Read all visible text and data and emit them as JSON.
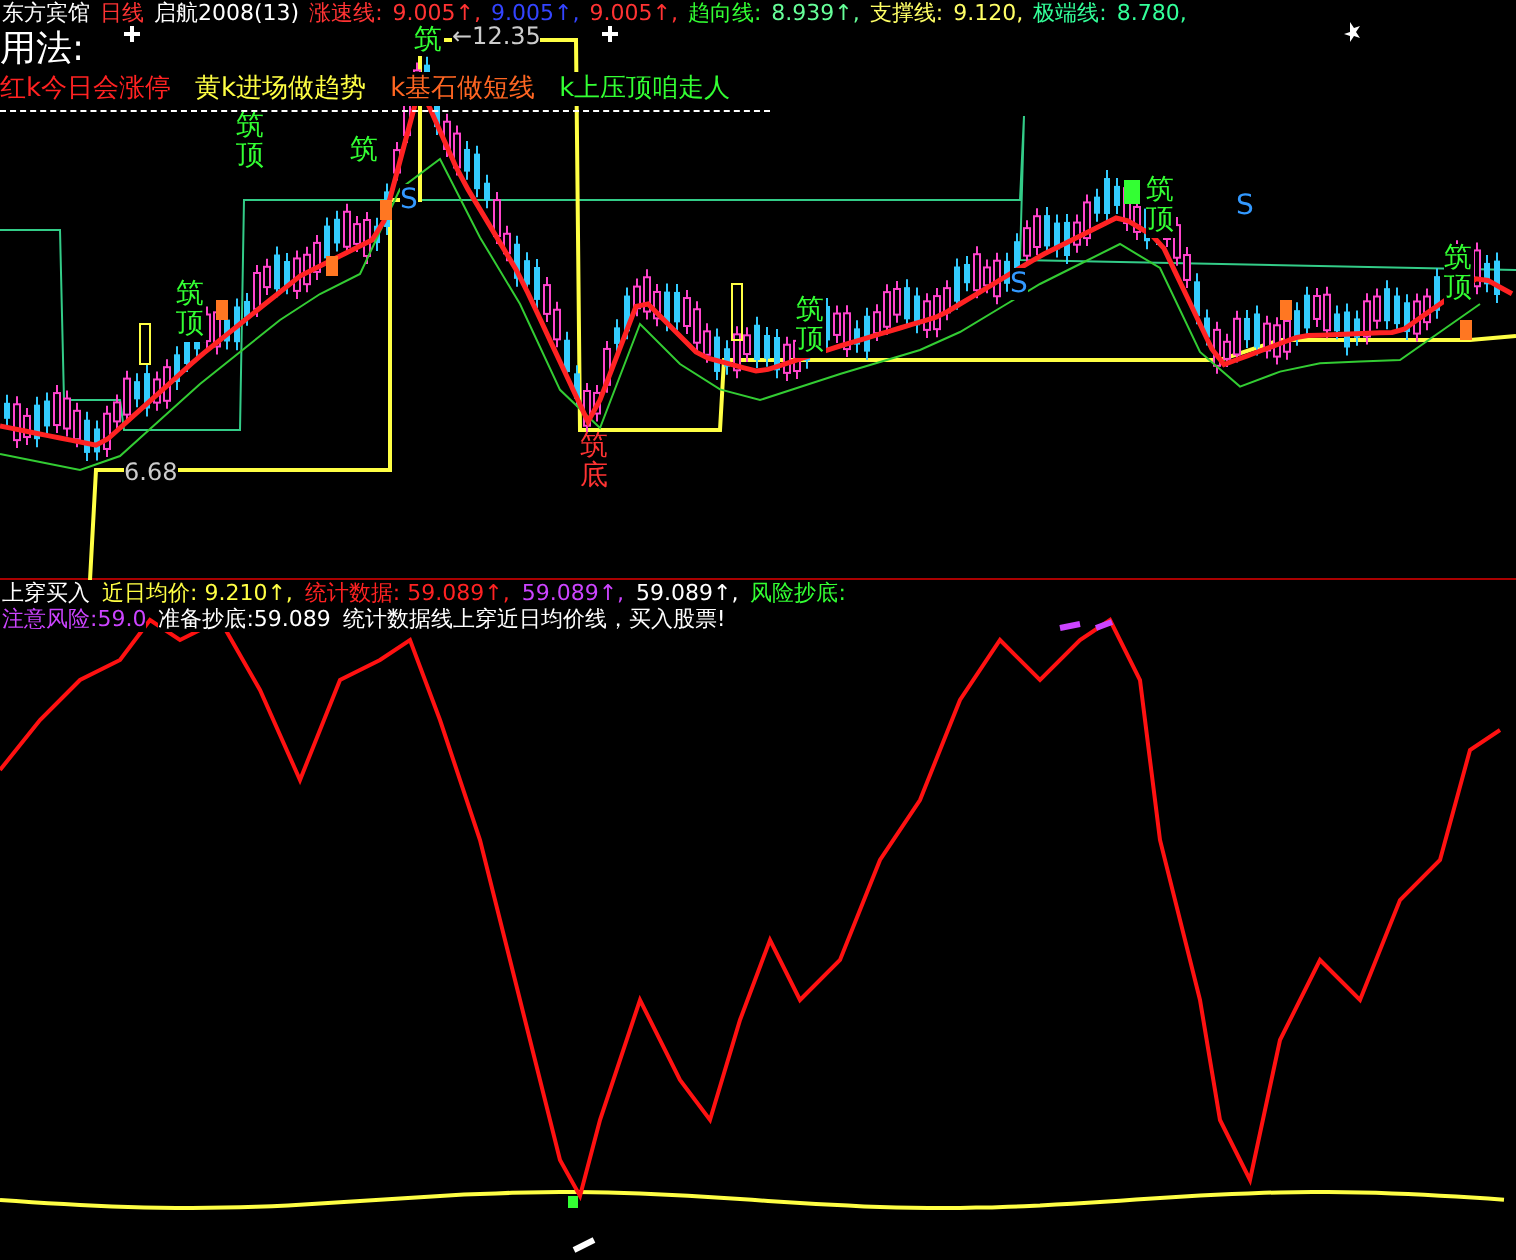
{
  "header": {
    "items": [
      {
        "text": "东方宾馆",
        "color": "#ffffff"
      },
      {
        "text": "日线",
        "color": "#ff3333"
      },
      {
        "text": "启航2008(13)",
        "color": "#ffffff"
      },
      {
        "text": "涨速线:",
        "color": "#ff3333"
      },
      {
        "text": "9.005↑,",
        "color": "#ff3333"
      },
      {
        "text": "9.005↑,",
        "color": "#3344ff"
      },
      {
        "text": "9.005↑,",
        "color": "#ff3333"
      },
      {
        "text": "趋向线:",
        "color": "#33ff33"
      },
      {
        "text": "8.939↑,",
        "color": "#66ff99"
      },
      {
        "text": "支撑线:",
        "color": "#ffff66"
      },
      {
        "text": "9.120,",
        "color": "#ffff66"
      },
      {
        "text": "极端线:",
        "color": "#33ff99"
      },
      {
        "text": "8.780,",
        "color": "#33ff99"
      }
    ]
  },
  "usage": {
    "title": "用法:",
    "legend": [
      {
        "text": "红k今日会涨停",
        "color": "#ff2222"
      },
      {
        "text": "黄k进场做趋势",
        "color": "#ffff44"
      },
      {
        "text": "k基石做短线",
        "color": "#ff6622"
      },
      {
        "text": "k上压顶咱走人",
        "color": "#33ff33"
      }
    ]
  },
  "main_chart": {
    "labels": [
      {
        "text": "←12.35",
        "kind": "price"
      },
      {
        "text": "筑",
        "kind": "top"
      },
      {
        "text": "筑顶",
        "kind": "top"
      },
      {
        "text": "筑",
        "kind": "top"
      },
      {
        "text": "筑顶",
        "kind": "top"
      },
      {
        "text": "S",
        "kind": "s"
      },
      {
        "text": "筑顶",
        "kind": "top"
      },
      {
        "text": "S",
        "kind": "s"
      },
      {
        "text": "筑顶",
        "kind": "top"
      },
      {
        "text": "S",
        "kind": "s"
      },
      {
        "text": "筑顶",
        "kind": "top"
      },
      {
        "text": "筑底",
        "kind": "bottom"
      },
      {
        "text": "6.68",
        "kind": "price"
      }
    ]
  },
  "indicator": {
    "line1": [
      {
        "text": "上穿买入",
        "color": "#ffffff"
      },
      {
        "text": "近日均价: 9.210↑,",
        "color": "#ffff44"
      },
      {
        "text": "统计数据: 59.089↑,",
        "color": "#ff2222"
      },
      {
        "text": "59.089↑,",
        "color": "#cc44ff"
      },
      {
        "text": "59.089↑,",
        "color": "#ffffff"
      },
      {
        "text": "风险抄底:",
        "color": "#33ff33"
      }
    ],
    "line2": [
      {
        "text": "注意风险:59.0",
        "color": "#cc44ff"
      },
      {
        "text": "准备抄底:59.089",
        "color": "#ffffff"
      },
      {
        "text": "统计数据线上穿近日均价线，买入股票!",
        "color": "#ffffff"
      }
    ]
  }
}
